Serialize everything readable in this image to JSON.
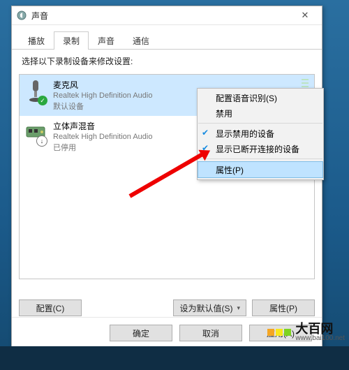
{
  "window": {
    "title": "声音",
    "close": "✕"
  },
  "tabs": [
    {
      "label": "播放"
    },
    {
      "label": "录制"
    },
    {
      "label": "声音"
    },
    {
      "label": "通信"
    }
  ],
  "activeTab": 1,
  "instruction": "选择以下录制设备来修改设置:",
  "devices": [
    {
      "name": "麦克风",
      "desc": "Realtek High Definition Audio",
      "status": "默认设备",
      "icon": "mic",
      "badge": "ok",
      "selected": true
    },
    {
      "name": "立体声混音",
      "desc": "Realtek High Definition Audio",
      "status": "已停用",
      "icon": "board",
      "badge": "down",
      "selected": false
    }
  ],
  "contextMenu": {
    "items": [
      {
        "label": "配置语音识别(S)",
        "check": false,
        "highlight": false
      },
      {
        "label": "禁用",
        "check": false,
        "highlight": false
      },
      {
        "sep": true
      },
      {
        "label": "显示禁用的设备",
        "check": true,
        "highlight": false
      },
      {
        "label": "显示已断开连接的设备",
        "check": true,
        "highlight": false
      },
      {
        "sep": true
      },
      {
        "label": "属性(P)",
        "check": false,
        "highlight": true
      }
    ]
  },
  "footer": {
    "configure": "配置(C)",
    "setDefault": "设为默认值(S)",
    "properties": "属性(P)",
    "ok": "确定",
    "cancel": "取消",
    "apply": "应用(A)"
  },
  "watermark": {
    "cn": "大百网",
    "en": "www.bai100.net"
  },
  "colors": {
    "selection": "#cde8ff",
    "menuHighlight": "#bfe3ff",
    "arrow": "#e00"
  }
}
